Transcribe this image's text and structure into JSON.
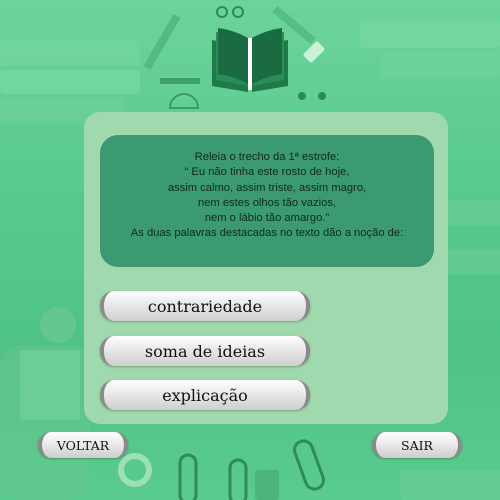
{
  "question": {
    "lines": [
      "Releia o trecho da 1ª estrofe:",
      "“ Eu não tinha este rosto de hoje,",
      "assim calmo, assim triste, assim magro,",
      "nem estes olhos tão vazios,",
      "nem o lábio tão amargo.”",
      "As duas palavras destacadas no texto dão a noção de:"
    ]
  },
  "options": [
    {
      "label": "contrariedade"
    },
    {
      "label": "soma de ideias"
    },
    {
      "label": "explicação"
    }
  ],
  "nav": {
    "back_label": "VOLTAR",
    "exit_label": "SAIR"
  },
  "colors": {
    "background": "#5acb8f",
    "card": "#9fd9ad",
    "question_box": "#3b9a72",
    "logo": "#1f7a4a"
  },
  "icons": [
    "open-book-icon"
  ]
}
